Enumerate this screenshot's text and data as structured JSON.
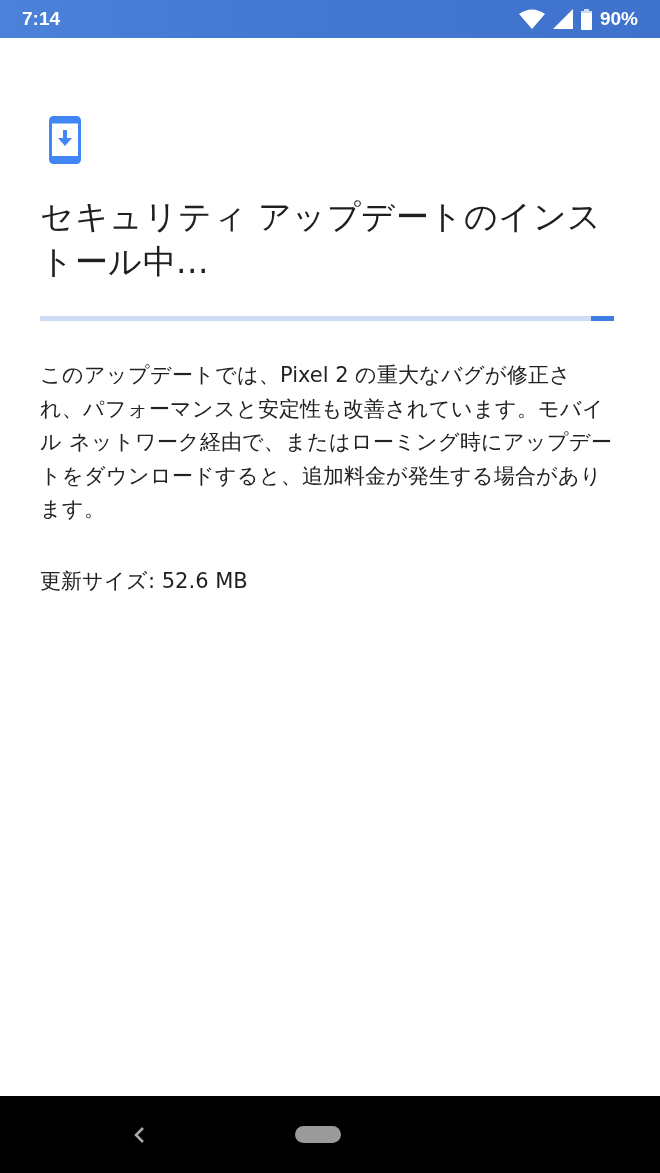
{
  "status_bar": {
    "time": "7:14",
    "battery": "90%"
  },
  "title": "セキュリティ アップデートのインストール中...",
  "progress": {
    "level": 0.04
  },
  "description": "このアップデートでは、Pixel 2 の重大なバグが修正され、パフォーマンスと安定性も改善されています。モバイル ネットワーク経由で、またはローミング時にアップデートをダウンロードすると、追加料金が発生する場合があります。",
  "update_size": "更新サイズ: 52.6 MB"
}
